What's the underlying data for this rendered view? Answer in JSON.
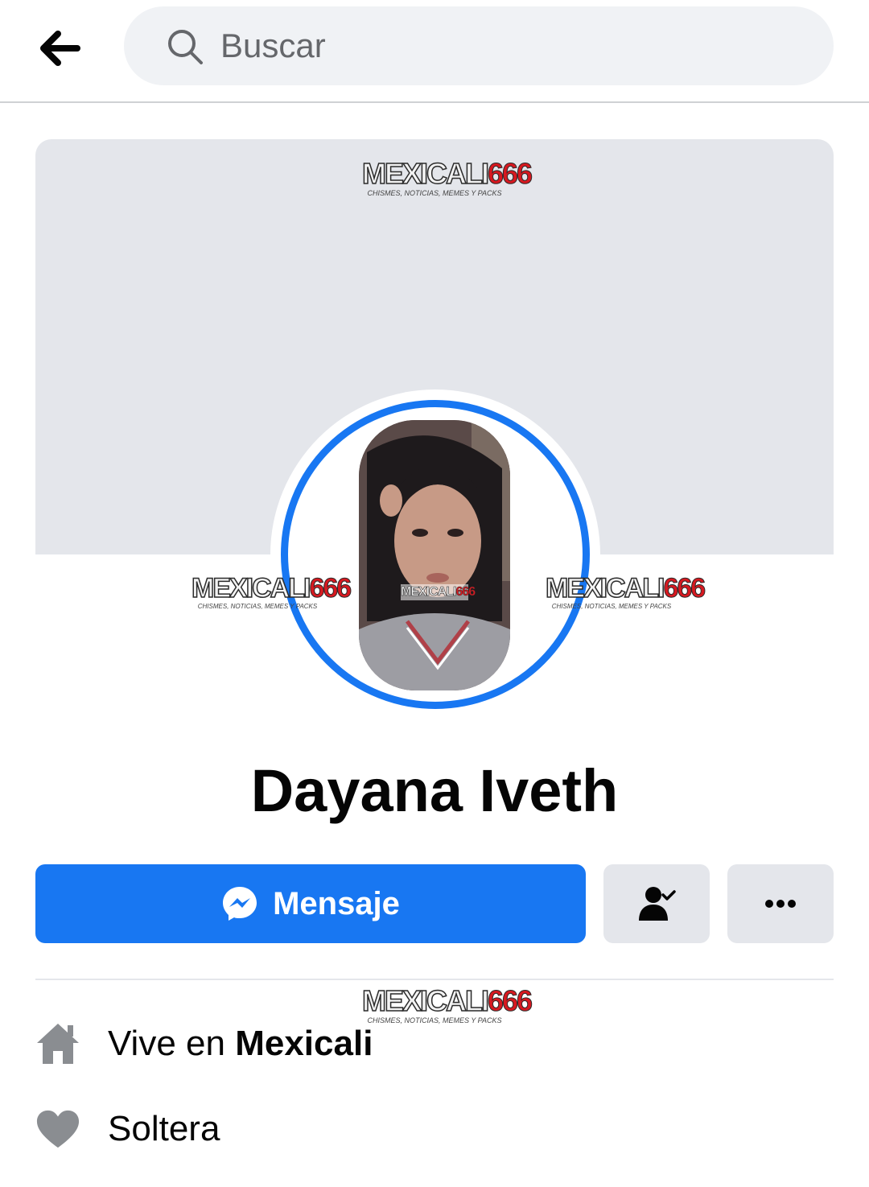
{
  "search": {
    "placeholder": "Buscar"
  },
  "watermark": {
    "brand_a": "MEXICALI",
    "brand_b": "666",
    "tagline": "CHISMES, NOTICIAS, MEMES Y PACKS"
  },
  "profile": {
    "name": "Dayana Iveth"
  },
  "actions": {
    "message_label": "Mensaje"
  },
  "intro": {
    "lives_prefix": "Vive en",
    "lives_city": "Mexicali",
    "relationship": "Soltera"
  },
  "colors": {
    "accent": "#1877f2",
    "cover": "#e4e6eb",
    "icon_gray": "#8a8d91"
  },
  "icons": [
    "back-arrow-icon",
    "search-icon",
    "messenger-icon",
    "friends-check-icon",
    "more-dots-icon",
    "home-icon",
    "heart-icon"
  ]
}
